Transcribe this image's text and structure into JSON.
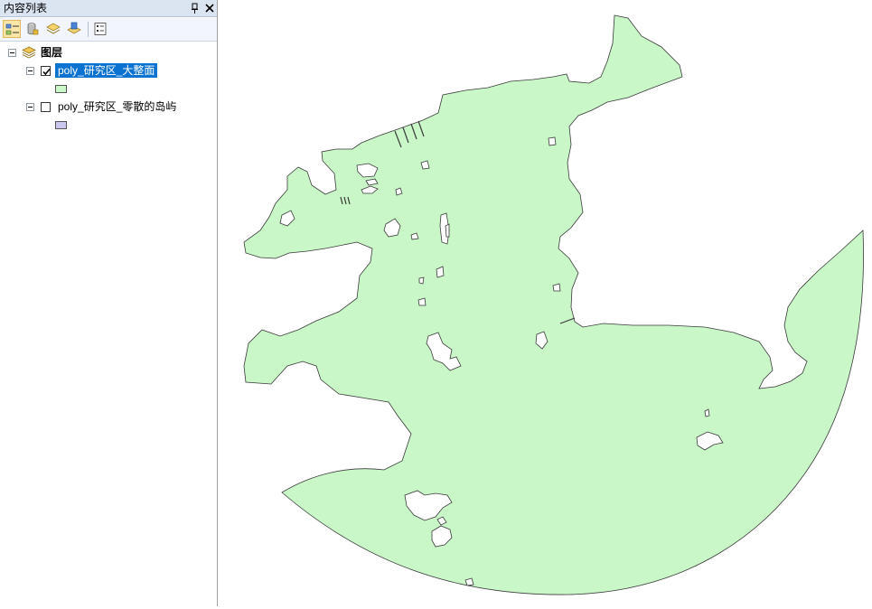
{
  "toc": {
    "title": "内容列表",
    "pin_icon": "pin-icon",
    "close_icon": "close-icon",
    "toolbar": [
      {
        "name": "list-by-drawing-order",
        "icon": "drawing-order-icon",
        "active": true
      },
      {
        "name": "list-by-source",
        "icon": "source-icon",
        "active": false
      },
      {
        "name": "list-by-visibility",
        "icon": "visibility-icon",
        "active": false
      },
      {
        "name": "list-by-selection",
        "icon": "selection-icon",
        "active": false
      },
      {
        "name": "options",
        "icon": "options-icon",
        "active": false
      }
    ],
    "group": {
      "label": "图层",
      "icon": "layers-icon"
    },
    "layers": [
      {
        "label": "poly_研究区_大整面",
        "checked": true,
        "selected": true,
        "swatch_color": "#c9f7c8"
      },
      {
        "label": "poly_研究区_零散的岛屿",
        "checked": false,
        "selected": false,
        "swatch_color": "#c9c6f0"
      }
    ]
  },
  "map": {
    "fill_color": "#c9f7c8",
    "stroke_color": "#3a3a3a"
  }
}
